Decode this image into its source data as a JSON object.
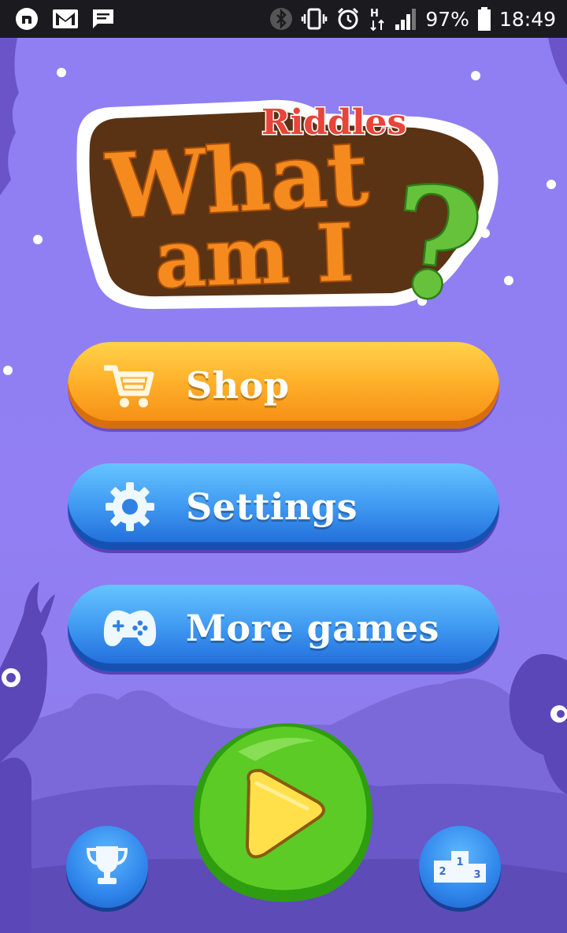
{
  "status_bar": {
    "battery": "97%",
    "time": "18:49",
    "icons": [
      "notification-app-icon",
      "gmail-icon",
      "message-icon",
      "bluetooth-icon",
      "vibrate-icon",
      "alarm-icon",
      "hspa-data-icon",
      "signal-icon",
      "battery-icon"
    ]
  },
  "logo": {
    "small": "Riddles",
    "line1": "What",
    "line2": "am I",
    "mark": "?"
  },
  "menu": {
    "shop": "Shop",
    "settings": "Settings",
    "more_games": "More games"
  },
  "podium": {
    "first": "1",
    "second": "2",
    "third": "3"
  },
  "colors": {
    "background": "#8f7df0",
    "shop_button": "#ffb12b",
    "blue_button": "#3f98f1",
    "play_button": "#5ccb25",
    "logo_orange": "#f58a1f",
    "logo_green": "#66c23a"
  }
}
